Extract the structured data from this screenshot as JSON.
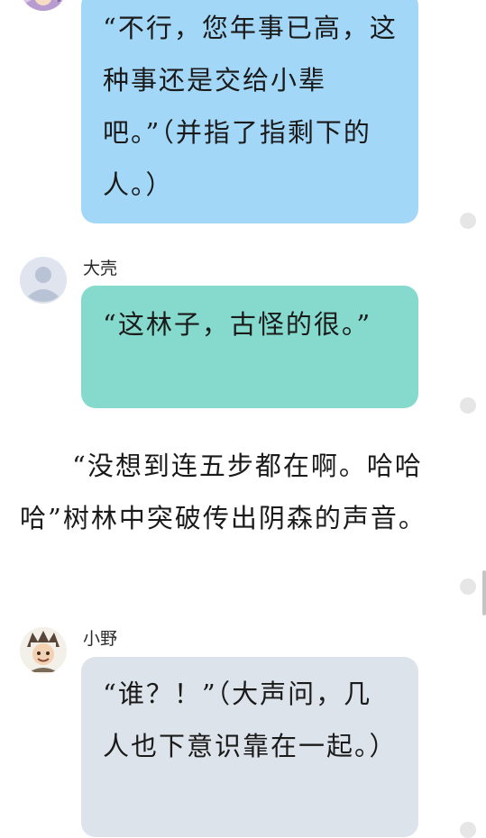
{
  "messages": [
    {
      "speaker": "",
      "text": "“不行，您年事已高，这种事还是交给小辈吧。”（并指了指剩下的人。）"
    },
    {
      "speaker": "大壳",
      "text": "“这林子，古怪的很。”"
    },
    {
      "speaker": "小野",
      "text": "“谁？！”（大声问，几人也下意识靠在一起。）"
    }
  ],
  "narration": "“没想到连五步都在啊。哈哈哈”树林中突破传出阴森的声音。",
  "colors": {
    "bubble_blue": "#a3d7f8",
    "bubble_teal": "#86dacd",
    "bubble_gray": "#dde3ea",
    "status_dot": "#e6e6e6"
  },
  "icons": {
    "top_avatar": "character-avatar",
    "default_avatar": "default-user-avatar",
    "xiaoye_avatar": "character-avatar"
  }
}
